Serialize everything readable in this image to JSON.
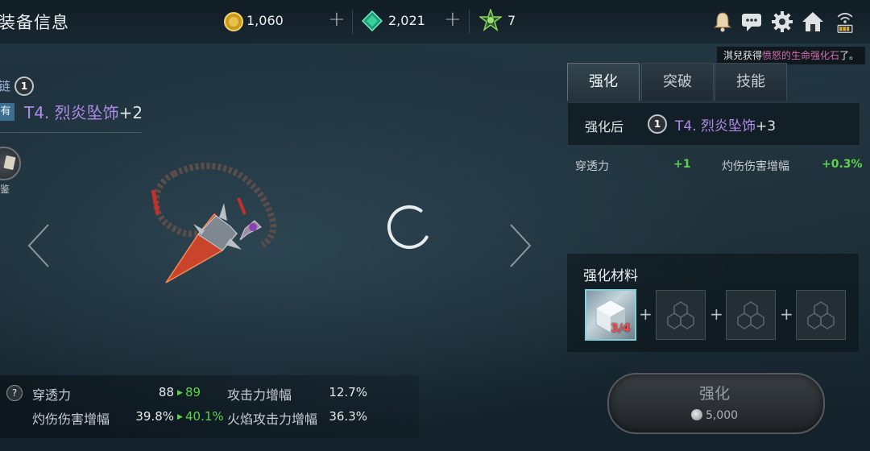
{
  "header": {
    "title": "装备信息",
    "currencies": [
      {
        "icon": "gold-coin-icon",
        "value": "1,060"
      },
      {
        "icon": "green-gem-icon",
        "value": "2,021"
      },
      {
        "icon": "energy-crystal-icon",
        "value": "7"
      }
    ],
    "plus_symbol": "+",
    "icons": [
      "bell-icon",
      "chat-icon",
      "gear-icon",
      "home-icon",
      "wifi-battery-icon"
    ]
  },
  "notice": {
    "prefix": "淇兒获得",
    "highlight": "愤怒的生命强化石",
    "suffix": "了。"
  },
  "item": {
    "type_label": "链",
    "tier": "1",
    "owned_tag": "有",
    "name": "T4. 烈炎坠饰",
    "enhance": "+2",
    "appraise_label": "鉴"
  },
  "loading": true,
  "stats": [
    {
      "label": "穿透力",
      "value": "88",
      "next": "89"
    },
    {
      "label": "攻击力增幅",
      "value": "12.7%",
      "next": ""
    },
    {
      "label": "灼伤伤害增幅",
      "value": "39.8%",
      "next": "40.1%"
    },
    {
      "label": "火焰攻击力增幅",
      "value": "36.3%",
      "next": ""
    }
  ],
  "help_symbol": "?",
  "tabs": [
    {
      "label": "强化",
      "active": true
    },
    {
      "label": "突破",
      "active": false
    },
    {
      "label": "技能",
      "active": false
    }
  ],
  "after": {
    "label": "强化后",
    "tier": "1",
    "name": "T4. 烈炎坠饰",
    "enhance": "+3",
    "stats": [
      {
        "label": "穿透力",
        "delta": "+1"
      },
      {
        "label": "灼伤伤害增幅",
        "delta": "+0.3%"
      }
    ]
  },
  "materials": {
    "title": "强化材料",
    "count": "3/4",
    "slots": [
      "filled",
      "empty",
      "empty",
      "empty"
    ]
  },
  "enhance_button": {
    "label": "强化",
    "cost": "5,000"
  },
  "colors": {
    "purple_name": "#b08be8",
    "green_up": "#5bd34a",
    "red_count": "#ff4b4b"
  }
}
